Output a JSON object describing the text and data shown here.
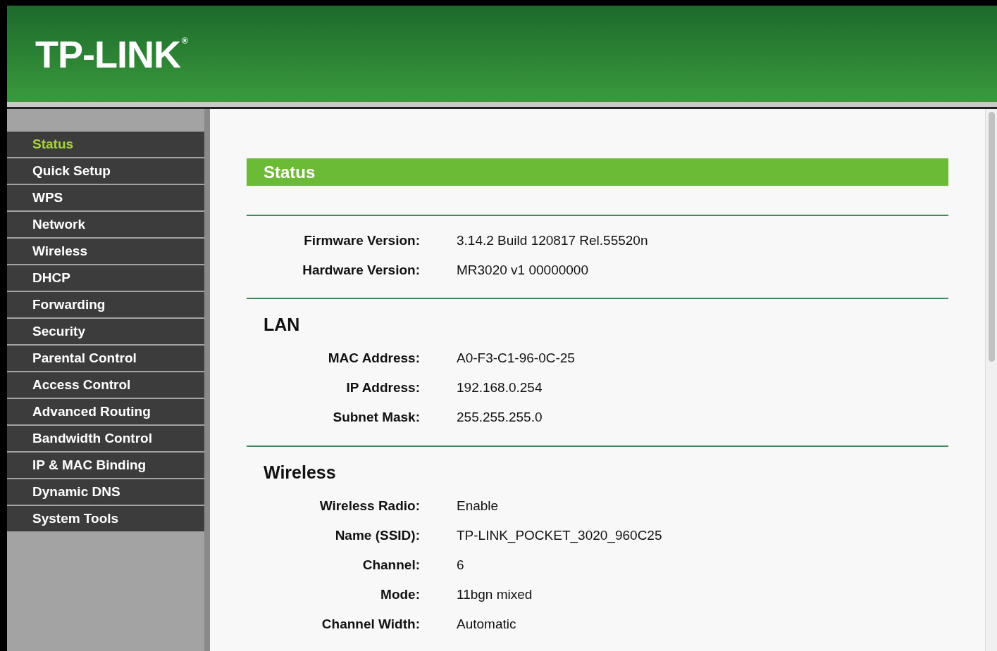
{
  "header": {
    "logo": "TP-LINK",
    "logo_mark": "®"
  },
  "sidebar": {
    "items": [
      {
        "label": "Status",
        "selected": true
      },
      {
        "label": "Quick Setup",
        "selected": false
      },
      {
        "label": "WPS",
        "selected": false
      },
      {
        "label": "Network",
        "selected": false
      },
      {
        "label": "Wireless",
        "selected": false
      },
      {
        "label": "DHCP",
        "selected": false
      },
      {
        "label": "Forwarding",
        "selected": false
      },
      {
        "label": "Security",
        "selected": false
      },
      {
        "label": "Parental Control",
        "selected": false
      },
      {
        "label": "Access Control",
        "selected": false
      },
      {
        "label": "Advanced Routing",
        "selected": false
      },
      {
        "label": "Bandwidth Control",
        "selected": false
      },
      {
        "label": "IP & MAC Binding",
        "selected": false
      },
      {
        "label": "Dynamic DNS",
        "selected": false
      },
      {
        "label": "System Tools",
        "selected": false
      }
    ]
  },
  "page_title": "Status",
  "sections": [
    {
      "rows": [
        {
          "label": "Firmware Version:",
          "value": "3.14.2 Build 120817 Rel.55520n"
        },
        {
          "label": "Hardware Version:",
          "value": "MR3020 v1 00000000"
        }
      ]
    },
    {
      "heading": "LAN",
      "rows": [
        {
          "label": "MAC Address:",
          "value": "A0-F3-C1-96-0C-25"
        },
        {
          "label": "IP Address:",
          "value": "192.168.0.254"
        },
        {
          "label": "Subnet Mask:",
          "value": "255.255.255.0"
        }
      ]
    },
    {
      "heading": "Wireless",
      "rows": [
        {
          "label": "Wireless Radio:",
          "value": "Enable"
        },
        {
          "label": "Name (SSID):",
          "value": "TP-LINK_POCKET_3020_960C25"
        },
        {
          "label": "Channel:",
          "value": "6"
        },
        {
          "label": "Mode:",
          "value": "11bgn mixed"
        },
        {
          "label": "Channel Width:",
          "value": "Automatic"
        }
      ]
    }
  ]
}
